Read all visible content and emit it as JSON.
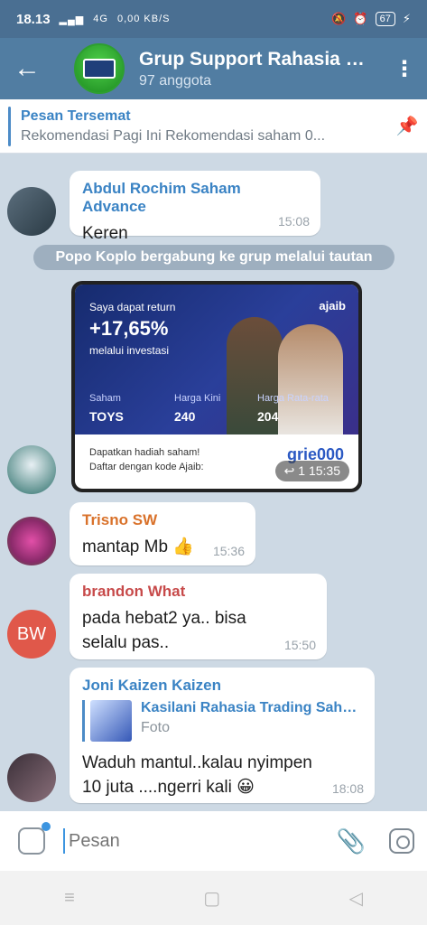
{
  "status": {
    "time": "18.13",
    "net": "4G",
    "speed": "0,00 KB/S",
    "battery": "67"
  },
  "header": {
    "title": "Grup Support Rahasia Trading Saham",
    "subtitle": "97 anggota"
  },
  "pinned": {
    "title": "Pesan Tersemat",
    "text": "Rekomendasi Pagi Ini  Rekomendasi saham 0..."
  },
  "messages": [
    {
      "sender": "Abdul Rochim Saham Advance",
      "sender_color": "#3a83c4",
      "text": "Keren",
      "time": "15:08"
    },
    {
      "service": "Popo Koplo bergabung ke grup melalui tautan"
    },
    {
      "image_post": {
        "line1": "Saya dapat return",
        "big": "+17,65%",
        "line3": "melalui investasi",
        "logo": "ajaib",
        "stat1_label": "Saham",
        "stat1_value": "TOYS",
        "stat2_label": "Harga Kini",
        "stat2_value": "240",
        "stat3_label": "Harga Rata-rata",
        "stat3_value": "204",
        "bottom1": "Dapatkan hadiah saham!",
        "bottom2": "Daftar dengan kode Ajaib:",
        "code": "grie000",
        "replies": "1",
        "time": "15:35"
      }
    },
    {
      "sender": "Trisno SW",
      "sender_color": "#d9722b",
      "text": "mantap Mb 👍",
      "time": "15:36"
    },
    {
      "sender": "brandon What",
      "sender_color": "#c74a4a",
      "text": "pada hebat2 ya.. bisa selalu pas..",
      "time": "15:50",
      "avatar_initials": "BW"
    },
    {
      "sender": "Joni Kaizen Kaizen",
      "sender_color": "#3a83c4",
      "reply_name": "Kasilani Rahasia Trading Saham",
      "reply_text": "Foto",
      "text": "Waduh mantul..kalau nyimpen 10 juta ....ngerri kali 😀",
      "time": "18:08"
    }
  ],
  "input": {
    "placeholder": "Pesan"
  },
  "colors": {
    "header": "#517da2",
    "status": "#4a6f92",
    "accent": "#3d95e0"
  }
}
